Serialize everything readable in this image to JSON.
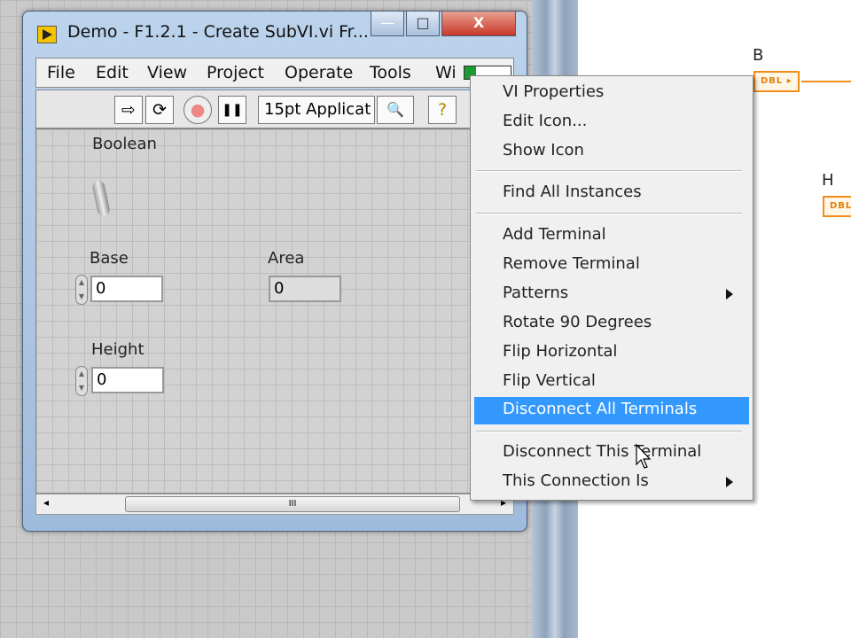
{
  "window": {
    "title": "Demo - F1.2.1 - Create SubVI.vi Fr...",
    "minimize": "—",
    "maximize": "□",
    "close": "X"
  },
  "menubar": [
    "File",
    "Edit",
    "View",
    "Project",
    "Operate",
    "Tools",
    "Wi"
  ],
  "toolbar": {
    "run": "⇨",
    "run_continuous": "⟳",
    "abort": "●",
    "pause": "❚❚",
    "font": "15pt Applicat",
    "search": "🔍",
    "help": "?"
  },
  "panel": {
    "boolean_label": "Boolean",
    "base_label": "Base",
    "base_value": "0",
    "area_label": "Area",
    "area_value": "0",
    "height_label": "Height",
    "height_value": "0"
  },
  "scroll": {
    "grip": "III",
    "left": "◂",
    "right": "▸"
  },
  "context_menu": {
    "items": [
      "VI Properties",
      "Edit Icon...",
      "Show Icon",
      "Find All Instances",
      "Add Terminal",
      "Remove Terminal",
      "Patterns",
      "Rotate 90 Degrees",
      "Flip Horizontal",
      "Flip Vertical",
      "Disconnect All Terminals",
      "Disconnect This Terminal",
      "This Connection Is"
    ],
    "selected": "Disconnect All Terminals"
  },
  "diagram": {
    "b_label": "B",
    "b_type": "DBL",
    "h_label": "H",
    "h_type": "DBL",
    "wire_color": "#f28c1a"
  }
}
